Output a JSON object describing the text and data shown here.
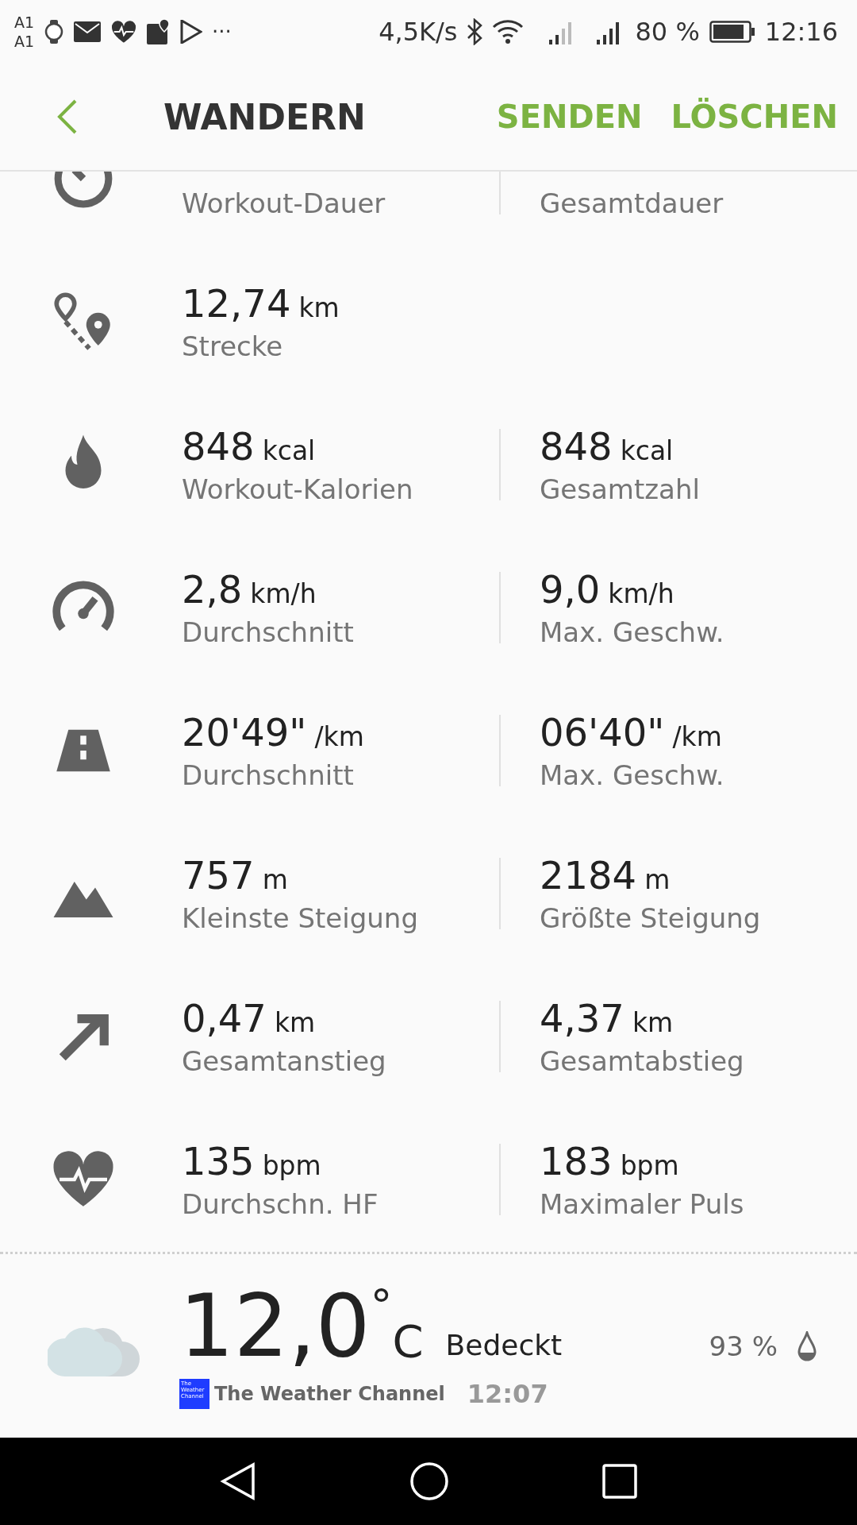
{
  "status_bar": {
    "carrier_top": "A1",
    "carrier_bottom": "A1",
    "more": "···",
    "speed": "4,5K/s",
    "battery": "80 %",
    "time": "12:16"
  },
  "header": {
    "title": "WANDERN",
    "actions": [
      "SENDEN",
      "LÖSCHEN"
    ]
  },
  "metrics": [
    {
      "kind": "timer",
      "left": {
        "label": "Workout-Dauer"
      },
      "right": {
        "label": "Gesamtdauer"
      }
    },
    {
      "kind": "route",
      "left": {
        "value": "12,74",
        "unit": "km",
        "label": "Strecke"
      }
    },
    {
      "kind": "flame",
      "left": {
        "value": "848",
        "unit": "kcal",
        "label": "Workout-Kalorien"
      },
      "right": {
        "value": "848",
        "unit": "kcal",
        "label": "Gesamtzahl"
      }
    },
    {
      "kind": "speedometer",
      "left": {
        "value": "2,8",
        "unit": "km/h",
        "label": "Durchschnitt"
      },
      "right": {
        "value": "9,0",
        "unit": "km/h",
        "label": "Max. Geschw."
      }
    },
    {
      "kind": "road",
      "left": {
        "value": "20'49\"",
        "unit": "/km",
        "label": "Durchschnitt"
      },
      "right": {
        "value": "06'40\"",
        "unit": "/km",
        "label": "Max. Geschw."
      }
    },
    {
      "kind": "mountain",
      "left": {
        "value": "757",
        "unit": "m",
        "label": "Kleinste Steigung"
      },
      "right": {
        "value": "2184",
        "unit": "m",
        "label": "Größte Steigung"
      }
    },
    {
      "kind": "arrow",
      "left": {
        "value": "0,47",
        "unit": "km",
        "label": "Gesamtanstieg"
      },
      "right": {
        "value": "4,37",
        "unit": "km",
        "label": "Gesamtabstieg"
      }
    },
    {
      "kind": "heart",
      "left": {
        "value": "135",
        "unit": "bpm",
        "label": "Durchschn. HF"
      },
      "right": {
        "value": "183",
        "unit": "bpm",
        "label": "Maximaler Puls"
      }
    }
  ],
  "weather": {
    "temperature": "12,0",
    "degree": "°",
    "unit": "C",
    "condition": "Bedeckt",
    "humidity": "93 %",
    "logo_text": "The Weather Channel",
    "provider": "The Weather Channel",
    "time": "12:07"
  }
}
